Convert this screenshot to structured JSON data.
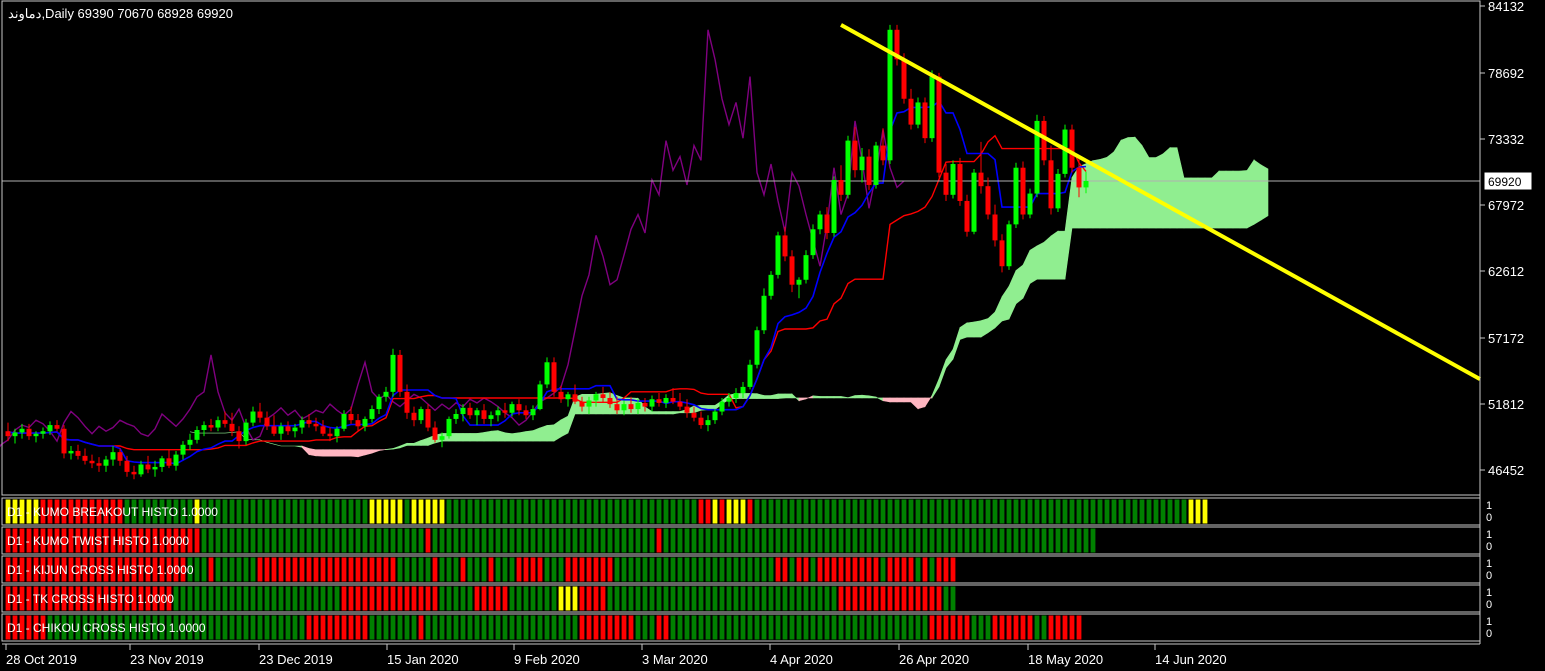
{
  "header": {
    "symbol": "دماوند",
    "timeframe": "Daily",
    "open": "69390",
    "high": "70670",
    "low": "68928",
    "close": "69920",
    "text": "دماوند,Daily  69390 70670 68928 69920"
  },
  "chart_data": {
    "type": "candlestick",
    "y_ticks": [
      "84132",
      "78692",
      "73332",
      "67972",
      "62612",
      "57172",
      "51812",
      "46452"
    ],
    "ylim": [
      44000,
      84700
    ],
    "current_price": "69920",
    "x_ticks": [
      "28 Oct 2019",
      "23 Nov 2019",
      "23 Dec 2019",
      "15 Jan 2020",
      "9 Feb 2020",
      "3 Mar 2020",
      "4 Apr 2020",
      "26 Apr 2020",
      "18 May 2020",
      "14 Jun 2020"
    ],
    "candles": [
      [
        49600,
        50300,
        48800,
        49200
      ],
      [
        49200,
        49800,
        48600,
        49500
      ],
      [
        49500,
        50200,
        49000,
        49800
      ],
      [
        49800,
        50200,
        48900,
        49200
      ],
      [
        49200,
        49600,
        48700,
        49400
      ],
      [
        49400,
        49900,
        49000,
        49600
      ],
      [
        49600,
        50400,
        49300,
        50100
      ],
      [
        50100,
        50500,
        49600,
        49800
      ],
      [
        49800,
        50100,
        47400,
        47800
      ],
      [
        47800,
        48400,
        47300,
        48000
      ],
      [
        48000,
        48500,
        47300,
        47600
      ],
      [
        47600,
        48200,
        46900,
        47200
      ],
      [
        47200,
        47700,
        46600,
        47000
      ],
      [
        47000,
        47500,
        46300,
        46800
      ],
      [
        46800,
        47600,
        46300,
        47300
      ],
      [
        47300,
        48400,
        46800,
        47900
      ],
      [
        47900,
        48200,
        46800,
        47200
      ],
      [
        47200,
        47600,
        45900,
        46300
      ],
      [
        46300,
        46800,
        45700,
        46100
      ],
      [
        46100,
        47200,
        45900,
        46900
      ],
      [
        46900,
        47600,
        46200,
        46500
      ],
      [
        46500,
        47200,
        45900,
        46700
      ],
      [
        46700,
        47600,
        46300,
        47400
      ],
      [
        47400,
        48100,
        46600,
        46800
      ],
      [
        46800,
        48000,
        46400,
        47700
      ],
      [
        47700,
        48800,
        47300,
        48500
      ],
      [
        48500,
        49400,
        48100,
        48900
      ],
      [
        48900,
        50000,
        48600,
        49700
      ],
      [
        49700,
        50400,
        49200,
        50100
      ],
      [
        50100,
        50600,
        49600,
        49900
      ],
      [
        49900,
        50800,
        49600,
        50500
      ],
      [
        50500,
        51200,
        49900,
        50200
      ],
      [
        50200,
        51100,
        49200,
        49600
      ],
      [
        49600,
        50000,
        48200,
        48800
      ],
      [
        48800,
        50600,
        48500,
        50300
      ],
      [
        50300,
        51600,
        50000,
        51200
      ],
      [
        51200,
        51900,
        50300,
        50700
      ],
      [
        50700,
        51200,
        49700,
        50000
      ],
      [
        50000,
        50900,
        49200,
        49400
      ],
      [
        49400,
        50300,
        48900,
        50000
      ],
      [
        50000,
        50400,
        49300,
        49600
      ],
      [
        49600,
        50200,
        49100,
        49900
      ],
      [
        49900,
        50800,
        49400,
        50500
      ],
      [
        50500,
        51000,
        49900,
        50200
      ],
      [
        50200,
        50700,
        49600,
        50000
      ],
      [
        50000,
        50500,
        49200,
        49400
      ],
      [
        49400,
        49900,
        48800,
        49200
      ],
      [
        49200,
        50000,
        48700,
        49800
      ],
      [
        49800,
        51300,
        49600,
        51000
      ],
      [
        51000,
        51600,
        50200,
        50500
      ],
      [
        50500,
        51000,
        49600,
        50000
      ],
      [
        50000,
        50800,
        49600,
        50600
      ],
      [
        50600,
        51700,
        50300,
        51400
      ],
      [
        51400,
        52600,
        51000,
        52400
      ],
      [
        52400,
        53200,
        52000,
        52800
      ],
      [
        52800,
        56300,
        52400,
        55800
      ],
      [
        55800,
        56200,
        52400,
        52800
      ],
      [
        52800,
        53400,
        50600,
        51100
      ],
      [
        51100,
        51600,
        50000,
        50500
      ],
      [
        50500,
        51600,
        50200,
        51400
      ],
      [
        51400,
        51800,
        49600,
        49900
      ],
      [
        49900,
        50400,
        48700,
        48900
      ],
      [
        48900,
        49500,
        48300,
        49200
      ],
      [
        49200,
        50800,
        49000,
        50600
      ],
      [
        50600,
        51400,
        50200,
        51000
      ],
      [
        51000,
        51800,
        50400,
        51500
      ],
      [
        51500,
        51900,
        50600,
        50900
      ],
      [
        50900,
        51500,
        50100,
        51300
      ],
      [
        51300,
        51800,
        50200,
        50600
      ],
      [
        50600,
        51200,
        50000,
        50900
      ],
      [
        50900,
        51600,
        50400,
        51300
      ],
      [
        51300,
        51900,
        50700,
        51100
      ],
      [
        51100,
        52000,
        50800,
        51800
      ],
      [
        51800,
        52200,
        50900,
        51300
      ],
      [
        51300,
        51700,
        50600,
        50900
      ],
      [
        50900,
        51700,
        50500,
        51400
      ],
      [
        51400,
        53700,
        51300,
        53400
      ],
      [
        53400,
        55600,
        53100,
        55200
      ],
      [
        55200,
        55600,
        52400,
        52800
      ],
      [
        52800,
        53300,
        51900,
        52200
      ],
      [
        52200,
        52800,
        51600,
        52600
      ],
      [
        52600,
        53400,
        51800,
        52000
      ],
      [
        52000,
        52400,
        51200,
        51600
      ],
      [
        51600,
        52400,
        51000,
        52100
      ],
      [
        52100,
        52800,
        51600,
        52600
      ],
      [
        52600,
        53200,
        51900,
        52300
      ],
      [
        52300,
        52800,
        51500,
        51800
      ],
      [
        51800,
        52400,
        51000,
        51300
      ],
      [
        51300,
        52100,
        50900,
        51800
      ],
      [
        51800,
        52400,
        51100,
        51400
      ],
      [
        51400,
        52200,
        51000,
        51900
      ],
      [
        51900,
        52300,
        51200,
        51600
      ],
      [
        51600,
        52500,
        51200,
        52200
      ],
      [
        52200,
        52700,
        51600,
        51900
      ],
      [
        51900,
        52600,
        51500,
        52300
      ],
      [
        52300,
        53100,
        51800,
        52000
      ],
      [
        52000,
        52700,
        51300,
        51600
      ],
      [
        51600,
        52200,
        50700,
        51100
      ],
      [
        51100,
        51600,
        50400,
        50700
      ],
      [
        50700,
        51200,
        49800,
        50100
      ],
      [
        50100,
        50900,
        49600,
        50500
      ],
      [
        50500,
        51400,
        50200,
        51200
      ],
      [
        51200,
        52300,
        50900,
        52000
      ],
      [
        52000,
        52700,
        51600,
        52300
      ],
      [
        52300,
        53100,
        51900,
        52700
      ],
      [
        52700,
        53600,
        52300,
        53200
      ],
      [
        53200,
        55400,
        53000,
        55000
      ],
      [
        55000,
        58100,
        54700,
        57800
      ],
      [
        57800,
        61200,
        57500,
        60600
      ],
      [
        60600,
        62600,
        60300,
        62300
      ],
      [
        62300,
        65800,
        62000,
        65500
      ],
      [
        65500,
        66200,
        63400,
        63800
      ],
      [
        63800,
        64300,
        60900,
        61500
      ],
      [
        61500,
        62100,
        60400,
        61900
      ],
      [
        61900,
        64300,
        61600,
        63900
      ],
      [
        63900,
        66400,
        63600,
        66000
      ],
      [
        66000,
        67500,
        65600,
        67200
      ],
      [
        67200,
        67800,
        65200,
        65700
      ],
      [
        65700,
        70300,
        65400,
        70000
      ],
      [
        70000,
        71200,
        68300,
        68800
      ],
      [
        68800,
        73600,
        68500,
        73200
      ],
      [
        73200,
        74300,
        70200,
        70800
      ],
      [
        70800,
        72600,
        69800,
        71900
      ],
      [
        71900,
        72500,
        69200,
        69600
      ],
      [
        69600,
        73100,
        69300,
        72800
      ],
      [
        72800,
        74200,
        71200,
        71600
      ],
      [
        71600,
        82600,
        71300,
        82200
      ],
      [
        82200,
        82600,
        79300,
        79800
      ],
      [
        79800,
        80300,
        76200,
        76600
      ],
      [
        76600,
        77400,
        74100,
        74500
      ],
      [
        74500,
        76700,
        74200,
        76300
      ],
      [
        76300,
        76700,
        73000,
        73400
      ],
      [
        73400,
        78900,
        73100,
        78400
      ],
      [
        78400,
        78700,
        70200,
        70600
      ],
      [
        70600,
        71300,
        68300,
        68800
      ],
      [
        68800,
        71600,
        68500,
        71300
      ],
      [
        71300,
        71800,
        67900,
        68300
      ],
      [
        68300,
        68800,
        65400,
        65800
      ],
      [
        65800,
        70900,
        65600,
        70600
      ],
      [
        70600,
        73100,
        68900,
        69500
      ],
      [
        69500,
        70200,
        66800,
        67200
      ],
      [
        67200,
        68000,
        64600,
        65100
      ],
      [
        65100,
        65600,
        62500,
        63000
      ],
      [
        63000,
        66700,
        62700,
        66400
      ],
      [
        66400,
        71400,
        66100,
        71000
      ],
      [
        71000,
        71500,
        66800,
        67200
      ],
      [
        67200,
        69300,
        66900,
        68900
      ],
      [
        68900,
        75300,
        68600,
        74800
      ],
      [
        74800,
        75200,
        71200,
        71600
      ],
      [
        71600,
        72800,
        67200,
        67700
      ],
      [
        67700,
        70900,
        67400,
        70500
      ],
      [
        70500,
        74500,
        70200,
        74100
      ],
      [
        74100,
        74500,
        70600,
        71000
      ],
      [
        71000,
        71700,
        68600,
        69400
      ],
      [
        69400,
        70670,
        68928,
        69920
      ]
    ],
    "series": [
      {
        "key": "tenkan",
        "color": "#0000ff"
      },
      {
        "key": "kijun",
        "color": "#ff0000"
      },
      {
        "key": "chikou",
        "color": "#800080"
      },
      {
        "key": "senkou_a"
      },
      {
        "key": "senkou_b"
      }
    ],
    "trendline": {
      "color": "#ffff00",
      "x": [
        119,
        185
      ],
      "y": [
        82600,
        61800
      ]
    }
  },
  "histograms": [
    {
      "label": "D1 - KUMO BREAKOUT HISTO 1.0000",
      "runs": [
        [
          "y",
          5
        ],
        [
          "r",
          12
        ],
        [
          "g",
          10
        ],
        [
          "y",
          1
        ],
        [
          "g",
          24
        ],
        [
          "y",
          5
        ],
        [
          "g",
          1
        ],
        [
          "y",
          5
        ],
        [
          "g",
          36
        ],
        [
          "r",
          2
        ],
        [
          "y",
          1
        ],
        [
          "r",
          1
        ],
        [
          "y",
          3
        ],
        [
          "r",
          1
        ],
        [
          "g",
          62
        ],
        [
          "y",
          3
        ]
      ],
      "scale": [
        "1",
        "0"
      ]
    },
    {
      "label": "D1 - KUMO TWIST HISTO 1.0000",
      "runs": [
        [
          "r",
          28
        ],
        [
          "g",
          32
        ],
        [
          "r",
          1
        ],
        [
          "g",
          32
        ],
        [
          "r",
          1
        ],
        [
          "g",
          62
        ]
      ],
      "scale": [
        "1",
        "0"
      ]
    },
    {
      "label": "D1 - KIJUN CROSS HISTO 1.0000",
      "runs": [
        [
          "r",
          26
        ],
        [
          "g",
          3
        ],
        [
          "r",
          1
        ],
        [
          "g",
          6
        ],
        [
          "r",
          20
        ],
        [
          "g",
          5
        ],
        [
          "r",
          1
        ],
        [
          "g",
          3
        ],
        [
          "r",
          1
        ],
        [
          "g",
          3
        ],
        [
          "r",
          1
        ],
        [
          "g",
          3
        ],
        [
          "r",
          4
        ],
        [
          "g",
          3
        ],
        [
          "r",
          7
        ],
        [
          "g",
          23
        ],
        [
          "r",
          2
        ],
        [
          "g",
          1
        ],
        [
          "r",
          2
        ],
        [
          "g",
          1
        ],
        [
          "r",
          9
        ],
        [
          "g",
          1
        ],
        [
          "r",
          4
        ],
        [
          "g",
          1
        ],
        [
          "r",
          1
        ],
        [
          "g",
          1
        ],
        [
          "r",
          3
        ]
      ],
      "scale": [
        "1",
        "0"
      ]
    },
    {
      "label": "D1 - TK CROSS HISTO 1.0000",
      "runs": [
        [
          "r",
          24
        ],
        [
          "g",
          24
        ],
        [
          "r",
          14
        ],
        [
          "g",
          5
        ],
        [
          "r",
          5
        ],
        [
          "g",
          7
        ],
        [
          "y",
          3
        ],
        [
          "r",
          4
        ],
        [
          "g",
          33
        ],
        [
          "r",
          15
        ],
        [
          "g",
          2
        ]
      ],
      "scale": [
        "1",
        "0"
      ]
    },
    {
      "label": "D1 - CHIKOU CROSS HISTO 1.0000",
      "runs": [
        [
          "r",
          6
        ],
        [
          "g",
          37
        ],
        [
          "r",
          9
        ],
        [
          "g",
          7
        ],
        [
          "r",
          1
        ],
        [
          "g",
          22
        ],
        [
          "r",
          8
        ],
        [
          "g",
          3
        ],
        [
          "r",
          2
        ],
        [
          "g",
          37
        ],
        [
          "r",
          6
        ],
        [
          "g",
          3
        ],
        [
          "r",
          6
        ],
        [
          "g",
          2
        ],
        [
          "r",
          5
        ]
      ],
      "scale": [
        "1",
        "0"
      ]
    }
  ]
}
